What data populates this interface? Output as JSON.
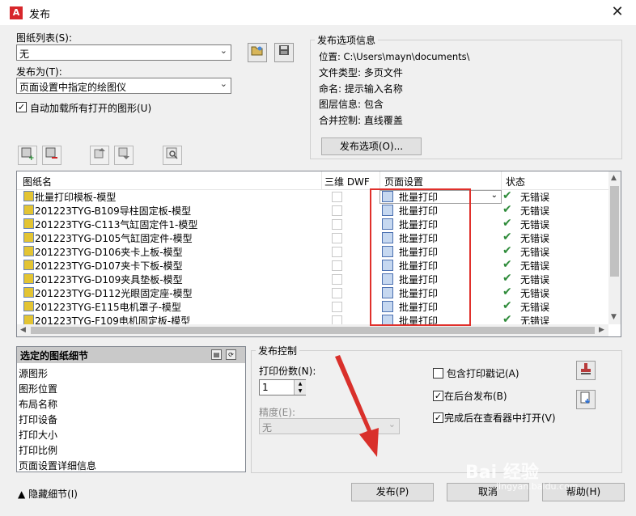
{
  "window": {
    "title": "发布",
    "close": "✕"
  },
  "sheet_list": {
    "label": "图纸列表(S):",
    "value": "无"
  },
  "publish_to": {
    "label": "发布为(T):",
    "value": "页面设置中指定的绘图仪"
  },
  "auto_load": {
    "label": "自动加载所有打开的图形(U)",
    "checked": "✓"
  },
  "info": {
    "title": "发布选项信息",
    "lines": [
      "位置: C:\\Users\\mayn\\documents\\",
      "文件类型: 多页文件",
      "命名: 提示输入名称",
      "图层信息: 包含",
      "合并控制: 直线覆盖"
    ],
    "options_button": "发布选项(O)..."
  },
  "table": {
    "headers": [
      "图纸名",
      "三维 DWF",
      "页面设置",
      "状态"
    ],
    "rows": [
      {
        "name": "批量打印模板-模型",
        "setup": "批量打印",
        "status": "无错误"
      },
      {
        "name": "201223TYG-B109导柱固定板-模型",
        "setup": "批量打印",
        "status": "无错误"
      },
      {
        "name": "201223TYG-C113气缸固定件1-模型",
        "setup": "批量打印",
        "status": "无错误"
      },
      {
        "name": "201223TYG-D105气缸固定件-模型",
        "setup": "批量打印",
        "status": "无错误"
      },
      {
        "name": "201223TYG-D106夹卡上板-模型",
        "setup": "批量打印",
        "status": "无错误"
      },
      {
        "name": "201223TYG-D107夹卡下板-模型",
        "setup": "批量打印",
        "status": "无错误"
      },
      {
        "name": "201223TYG-D109夹具垫板-模型",
        "setup": "批量打印",
        "status": "无错误"
      },
      {
        "name": "201223TYG-D112光眼固定座-模型",
        "setup": "批量打印",
        "status": "无错误"
      },
      {
        "name": "201223TYG-E115电机罩子-模型",
        "setup": "批量打印",
        "status": "无错误"
      },
      {
        "name": "201223TYG-F109电机固定板-模型",
        "setup": "批量打印",
        "status": "无错误"
      }
    ]
  },
  "details": {
    "title": "选定的图纸细节",
    "items": [
      "源图形",
      "图形位置",
      "布局名称",
      "打印设备",
      "打印大小",
      "打印比例",
      "页面设置详细信息"
    ]
  },
  "publish_control": {
    "title": "发布控制",
    "copies_label": "打印份数(N):",
    "copies_value": "1",
    "precision_label": "精度(E):",
    "precision_value": "无",
    "include_stamp": "包含打印戳记(A)",
    "background": "在后台发布(B)",
    "open_viewer": "完成后在查看器中打开(V)"
  },
  "footer": {
    "hide_details": "隐藏细节(I)",
    "publish": "发布(P)",
    "cancel": "取消",
    "help": "帮助(H)"
  },
  "watermark": {
    "main": "Bai 经验",
    "sub": "jingyan.baidu.com"
  },
  "colors": {
    "highlight_box": "#e0302b",
    "ok_check": "#2e8b3a",
    "arrow": "#d9302b"
  }
}
